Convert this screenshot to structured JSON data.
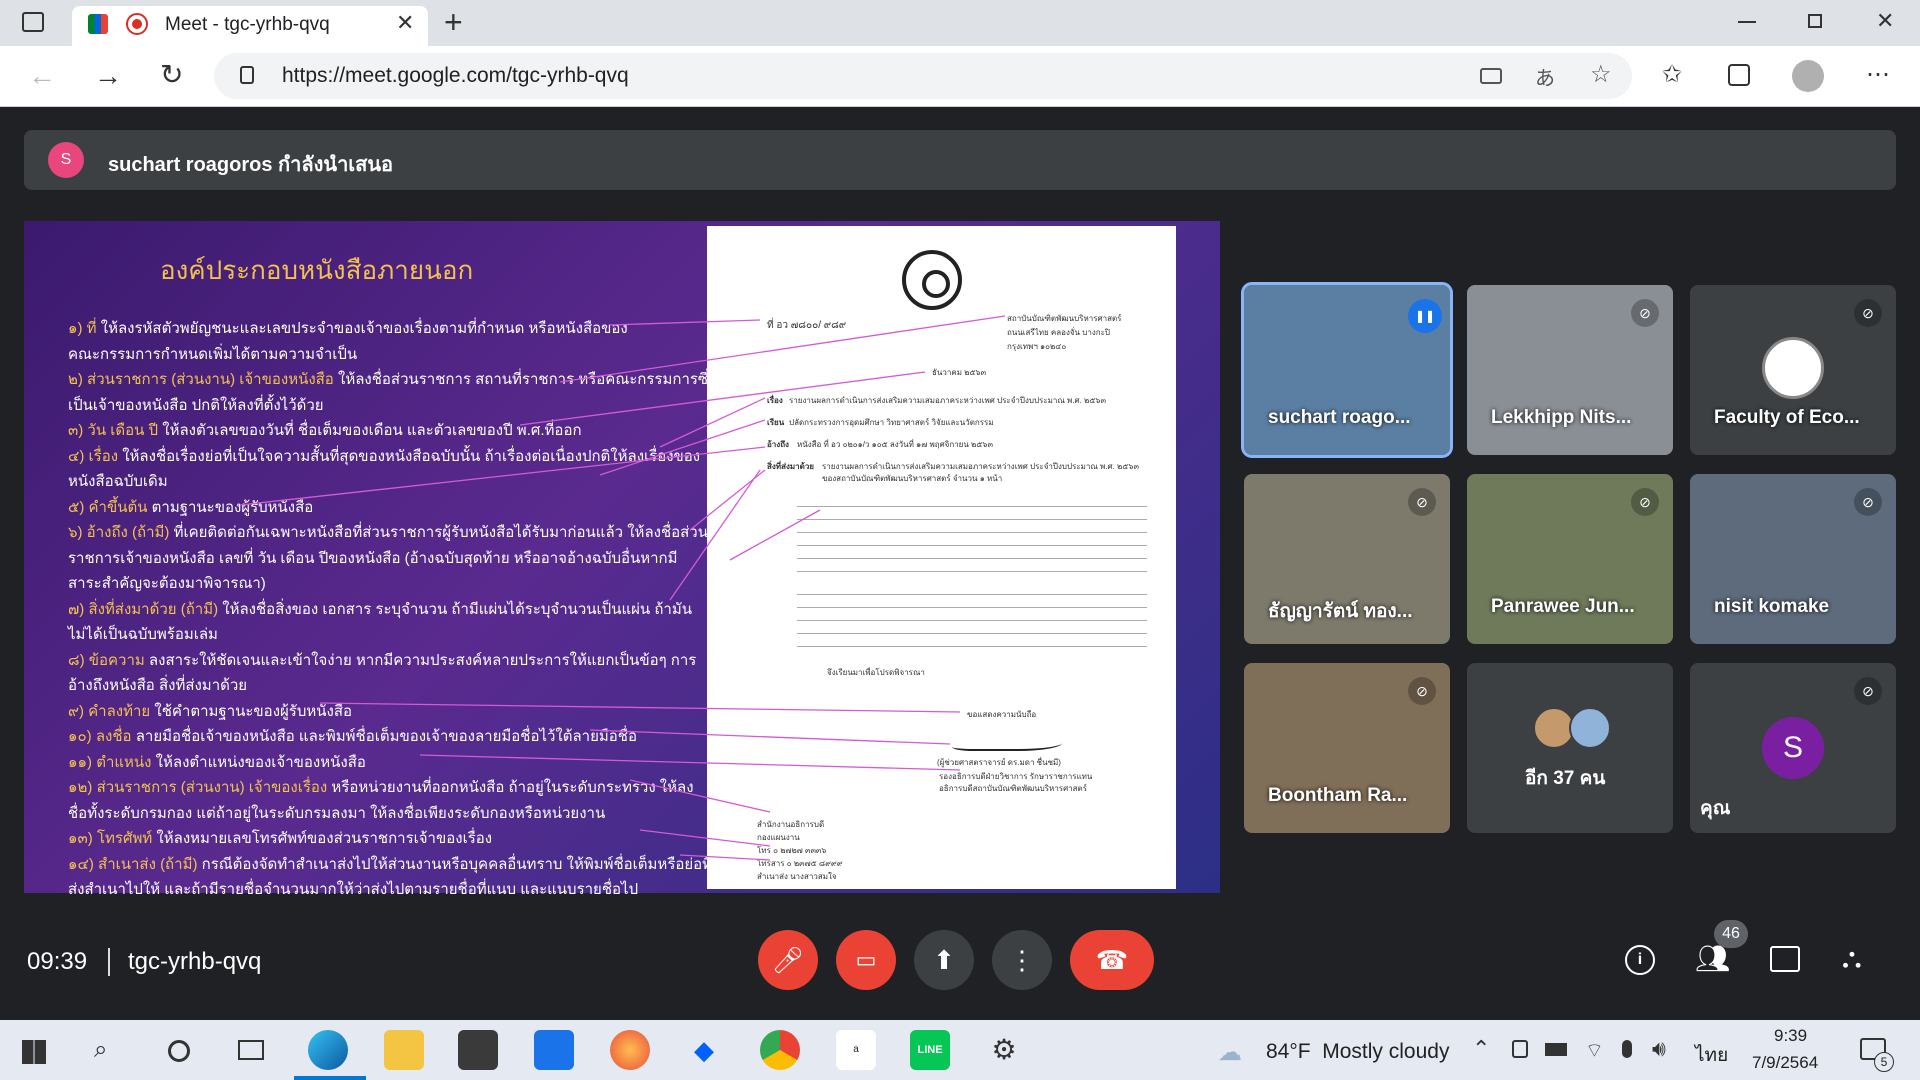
{
  "browser": {
    "tab_title": "Meet - tgc-yrhb-qvq",
    "new_tab": "+",
    "url": "https://meet.google.com/tgc-yrhb-qvq"
  },
  "meet": {
    "presenter_avatar": "S",
    "presenter_banner": "suchart roagoros กำลังนำเสนอ",
    "time": "09:39",
    "meeting_code": "tgc-yrhb-qvq",
    "participant_count": "46"
  },
  "slide": {
    "title": "องค์ประกอบหนังสือภายนอก",
    "lines": [
      {
        "kw": "๑) ที่",
        "rest": " ให้ลงรหัสตัวพยัญชนะและเลขประจำของเจ้าของเรื่องตามที่กำหนด หรือหนังสือของ"
      },
      {
        "kw": "",
        "rest": "คณะกรรมการกำหนดเพิ่มได้ตามความจำเป็น"
      },
      {
        "kw": "๒) ส่วนราชการ (ส่วนงาน) เจ้าของหนังสือ",
        "rest": " ให้ลงชื่อส่วนราชการ สถานที่ราชการ หรือคณะกรรมการซึ่ง"
      },
      {
        "kw": "",
        "rest": "เป็นเจ้าของหนังสือ ปกติให้ลงที่ตั้งไว้ด้วย"
      },
      {
        "kw": "๓) วัน เดือน ปี",
        "rest": " ให้ลงตัวเลขของวันที่ ชื่อเต็มของเดือน และตัวเลขของปี พ.ศ.ที่ออก"
      },
      {
        "kw": "๔) เรื่อง",
        "rest": " ให้ลงชื่อเรื่องย่อที่เป็นใจความสั้นที่สุดของหนังสือฉบับนั้น ถ้าเรื่องต่อเนื่องปกติให้ลงเรื่องของ"
      },
      {
        "kw": "",
        "rest": "หนังสือฉบับเดิม"
      },
      {
        "kw": "๕) คำขึ้นต้น",
        "rest": " ตามฐานะของผู้รับหนังสือ"
      },
      {
        "kw": "๖) อ้างถึง (ถ้ามี)",
        "rest": " ที่เคยติดต่อกันเฉพาะหนังสือที่ส่วนราชการผู้รับหนังสือได้รับมาก่อนแล้ว ให้ลงชื่อส่วน"
      },
      {
        "kw": "",
        "rest": "ราชการเจ้าของหนังสือ เลขที่ วัน เดือน ปีของหนังสือ (อ้างฉบับสุดท้าย หรืออาจอ้างฉบับอื่นหากมี"
      },
      {
        "kw": "",
        "rest": "สาระสำคัญจะต้องมาพิจารณา)"
      },
      {
        "kw": "๗) สิ่งที่ส่งมาด้วย (ถ้ามี)",
        "rest": " ให้ลงชื่อสิ่งของ เอกสาร ระบุจำนวน ถ้ามีแผ่นได้ระบุจำนวนเป็นแผ่น ถ้ามัน"
      },
      {
        "kw": "",
        "rest": "ไม่ได้เป็นฉบับพร้อมเล่ม"
      },
      {
        "kw": "๘) ข้อความ",
        "rest": " ลงสาระให้ชัดเจนและเข้าใจง่าย หากมีความประสงค์หลายประการให้แยกเป็นข้อๆ การ"
      },
      {
        "kw": "",
        "rest": "อ้างถึงหนังสือ สิ่งที่ส่งมาด้วย"
      },
      {
        "kw": "๙) คำลงท้าย",
        "rest": " ใช้คำตามฐานะของผู้รับหนังสือ"
      },
      {
        "kw": "๑๐) ลงชื่อ",
        "rest": " ลายมือชื่อเจ้าของหนังสือ และพิมพ์ชื่อเต็มของเจ้าของลายมือชื่อไว้ใต้ลายมือชื่อ"
      },
      {
        "kw": "๑๑) ตำแหน่ง",
        "rest": " ให้ลงตำแหน่งของเจ้าของหนังสือ"
      },
      {
        "kw": "๑๒) ส่วนราชการ (ส่วนงาน) เจ้าของเรื่อง",
        "rest": " หรือหน่วยงานที่ออกหนังสือ ถ้าอยู่ในระดับกระทรวง ให้ลง"
      },
      {
        "kw": "",
        "rest": "ชื่อทั้งระดับกรมกอง แต่ถ้าอยู่ในระดับกรมลงมา ให้ลงชื่อเพียงระดับกองหรือหน่วยงาน"
      },
      {
        "kw": "๑๓) โทรศัพท์",
        "rest": " ให้ลงหมายเลขโทรศัพท์ของส่วนราชการเจ้าของเรื่อง"
      },
      {
        "kw": "๑๔) สำเนาส่ง (ถ้ามี)",
        "rest": " กรณีต้องจัดทำสำเนาส่งไปให้ส่วนงานหรือบุคคลอื่นทราบ ให้พิมพ์ชื่อเต็มหรือย่อที่"
      },
      {
        "kw": "",
        "rest": "ส่งสำเนาไปให้ และถ้ามีรายชื่อจำนวนมากให้ว่าส่งไปตามรายชื่อที่แนบ และแนบรายชื่อไป"
      }
    ],
    "doc": {
      "number": "ที่ อว ๗๘๐๐/ ๙๘๙",
      "address": [
        "สถาบันบัณฑิตพัฒนบริหารศาสตร์",
        "ถนนเสรีไทย คลองจั่น บางกะปิ",
        "กรุงเทพฯ ๑๐๒๔๐"
      ],
      "date": "ธันวาคม ๒๕๖๓",
      "subject_label": "เรื่อง",
      "subject": "รายงานผลการดำเนินการส่งเสริมความเสมอภาคระหว่างเพศ ประจำปีงบประมาณ พ.ศ. ๒๕๖๓",
      "to_label": "เรียน",
      "to": "ปลัดกระทรวงการอุดมศึกษา วิทยาศาสตร์ วิจัยและนวัตกรรม",
      "ref_label": "อ้างถึง",
      "ref": "หนังสือ ที่ อว ๐๒๐๑/ว ๑๐๕ ลงวันที่ ๑๗ พฤศจิกายน ๒๕๖๓",
      "encl_label": "สิ่งที่ส่งมาด้วย",
      "encl": "รายงานผลการดำเนินการส่งเสริมความเสมอภาคระหว่างเพศ ประจำปีงบประมาณ พ.ศ. ๒๕๖๓",
      "encl2": "ของสถาบันบัณฑิตพัฒนบริหารศาสตร์ จำนวน ๑ หน้า",
      "closing": "ขอแสดงความนับถือ",
      "signer": "(ผู้ช่วยศาสตราจารย์ ดร.มดา ชื่นชมี)",
      "signer_pos": [
        "รองอธิการบดีฝ่ายวิชาการ รักษาราชการแทน",
        "อธิการบดีสถาบันบัณฑิตพัฒนบริหารศาสตร์"
      ],
      "footer": [
        "สำนักงานอธิการบดี",
        "กองแผนงาน",
        "โทร ๐ ๒๗๒๗ ๓๓๓๖",
        "โทรสาร ๐ ๒๓๗๕ ๘๙๙๙",
        "สำเนาส่ง นางสาวสมใจ"
      ],
      "request": "จึงเรียนมาเพื่อโปรดพิจารณา"
    }
  },
  "tiles": [
    {
      "name": "suchart roago...",
      "bg": "#5b7fa3"
    },
    {
      "name": "Lekkhipp Nits...",
      "bg": "#8a8f96"
    },
    {
      "name": "Faculty of Eco...",
      "bg": "#3c4043"
    },
    {
      "name": "ธัญญารัตน์ ทอง...",
      "bg": "#7d7a6c"
    },
    {
      "name": "Panrawee Jun...",
      "bg": "#6e7a5a"
    },
    {
      "name": "nisit komake",
      "bg": "#5d6b7c"
    },
    {
      "name": "Boontham Ra...",
      "bg": "#806f58"
    },
    {
      "name": "อีก 37 คน",
      "bg": "#3c4043"
    },
    {
      "name": "คุณ",
      "bg": "#3c4043",
      "avatar": "S"
    }
  ],
  "taskbar": {
    "weather": "84°F  Mostly cloudy",
    "lang": "ไทย",
    "time": "9:39",
    "date": "7/9/2564",
    "notif": "5"
  }
}
